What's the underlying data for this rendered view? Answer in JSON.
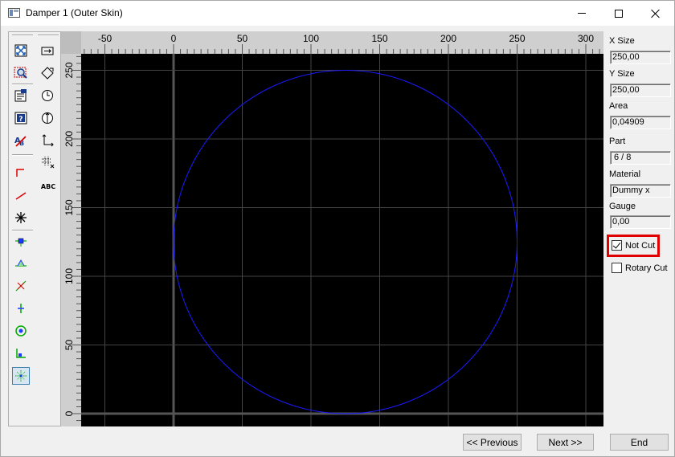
{
  "window": {
    "title": "Damper 1 (Outer Skin)"
  },
  "toolbox": {
    "col1": [
      "zoom-fit-icon",
      "zoom-window-icon",
      "properties-icon",
      "help-icon",
      "spell-icon",
      "step-line-icon",
      "line-icon",
      "cross-icon",
      "node-blue-icon",
      "node-green-icon",
      "slash-node-icon",
      "plus-node-icon",
      "circle-node-icon",
      "corner-node-icon",
      "snap-center-icon"
    ],
    "col2": [
      "resize-icon",
      "rotate-icon",
      "clock-icon",
      "rotate-circle-icon",
      "axis-icon",
      "grid-dots-icon"
    ],
    "abc_label": "ABC"
  },
  "canvas": {
    "background": "#000000",
    "grid_color": "#444444",
    "shape_color": "#1a1aff",
    "x_ticks": [
      "-50",
      "0",
      "50",
      "100",
      "150",
      "200",
      "250",
      "300"
    ],
    "y_ticks": [
      "0",
      "50",
      "100",
      "150",
      "200",
      "250"
    ]
  },
  "props": {
    "x_size_label": "X Size",
    "x_size_value": "250,00",
    "y_size_label": "Y Size",
    "y_size_value": "250,00",
    "area_label": "Area",
    "area_value": "0,04909",
    "part_label": "Part",
    "part_value": "6 / 8",
    "material_label": "Material",
    "material_value": "Dummy x",
    "gauge_label": "Gauge",
    "gauge_value": "0,00",
    "not_cut_label": "Not Cut",
    "not_cut_checked": true,
    "rotary_cut_label": "Rotary Cut",
    "rotary_cut_checked": false
  },
  "buttons": {
    "previous": "<< Previous",
    "next": "Next >>",
    "end": "End"
  }
}
